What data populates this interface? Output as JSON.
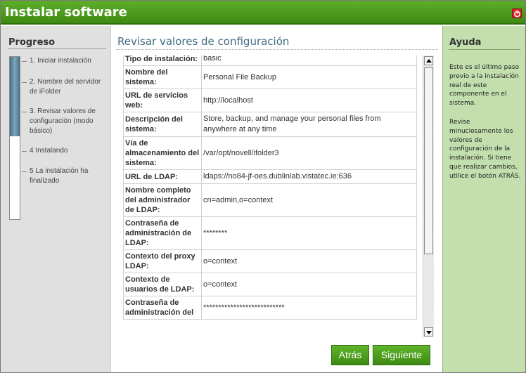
{
  "window": {
    "title": "Instalar software"
  },
  "progress": {
    "heading": "Progreso",
    "fill_fraction": 0.49,
    "steps": [
      "1. Iniciar instalación",
      "2. Nombre del servidor de iFolder",
      "3. Revisar valores de configuración (modo básico)",
      "4 Instalando",
      "5 La instalación ha finalizado"
    ]
  },
  "main": {
    "heading": "Revisar valores de configuración",
    "rows": [
      {
        "key": "Tipo de instalación:",
        "value": "basic"
      },
      {
        "key": "Nombre del sistema:",
        "value": "Personal File Backup"
      },
      {
        "key": "URL de servicios web:",
        "value": "http://localhost"
      },
      {
        "key": "Descripción del sistema:",
        "value": "Store, backup, and manage your personal files from anywhere at any time"
      },
      {
        "key": "Vía de almacenamiento del sistema:",
        "value": "/var/opt/novell/ifolder3"
      },
      {
        "key": "URL de LDAP:",
        "value": "ldaps://no84-jf-oes.dublinlab.vistatec.ie:636"
      },
      {
        "key": "Nombre completo del administrador de LDAP:",
        "value": "cn=admin,o=context"
      },
      {
        "key": "Contraseña de administración de LDAP:",
        "value": "********"
      },
      {
        "key": "Contexto del proxy LDAP:",
        "value": "o=context"
      },
      {
        "key": "Contexto de usuarios de LDAP:",
        "value": "o=context"
      },
      {
        "key": "Contraseña de administración del",
        "value": "***************************"
      }
    ]
  },
  "buttons": {
    "back": "Atrás",
    "next": "Siguiente"
  },
  "help": {
    "heading": "Ayuda",
    "p1": "Este es el último paso previo a la instalación real de este componente en el sistema.",
    "p2": "Revise minuciosamente los valores de configuración de la instalación. Si tiene que realizar cambios, utilice el botón ATRÁS."
  },
  "colors": {
    "titlebar": "#4b9a1e",
    "help_bg": "#c3dfae",
    "heading_blue": "#3f6a7f"
  },
  "icons": {
    "close": "close-icon"
  }
}
